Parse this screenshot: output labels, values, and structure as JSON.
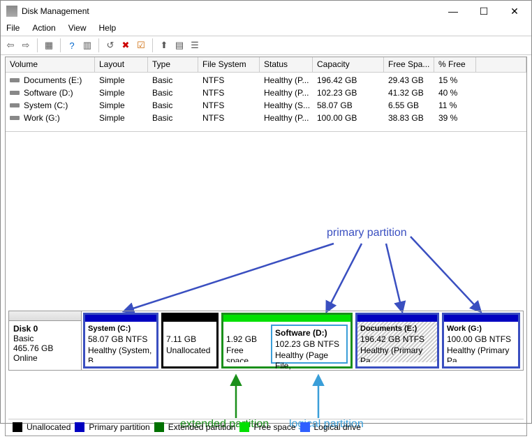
{
  "window": {
    "title": "Disk Management"
  },
  "menu": {
    "file": "File",
    "action": "Action",
    "view": "View",
    "help": "Help"
  },
  "columns": {
    "volume": "Volume",
    "layout": "Layout",
    "type": "Type",
    "fs": "File System",
    "status": "Status",
    "capacity": "Capacity",
    "free": "Free Spa...",
    "pct": "% Free"
  },
  "rows": [
    {
      "volume": "Documents (E:)",
      "layout": "Simple",
      "type": "Basic",
      "fs": "NTFS",
      "status": "Healthy (P...",
      "capacity": "196.42 GB",
      "free": "29.43 GB",
      "pct": "15 %"
    },
    {
      "volume": "Software (D:)",
      "layout": "Simple",
      "type": "Basic",
      "fs": "NTFS",
      "status": "Healthy (P...",
      "capacity": "102.23 GB",
      "free": "41.32 GB",
      "pct": "40 %"
    },
    {
      "volume": "System (C:)",
      "layout": "Simple",
      "type": "Basic",
      "fs": "NTFS",
      "status": "Healthy (S...",
      "capacity": "58.07 GB",
      "free": "6.55 GB",
      "pct": "11 %"
    },
    {
      "volume": "Work (G:)",
      "layout": "Simple",
      "type": "Basic",
      "fs": "NTFS",
      "status": "Healthy (P...",
      "capacity": "100.00 GB",
      "free": "38.83 GB",
      "pct": "39 %"
    }
  ],
  "disk": {
    "label": "Disk 0",
    "type": "Basic",
    "size": "465.76 GB",
    "state": "Online"
  },
  "parts": {
    "p0": {
      "name": "System  (C:)",
      "line2": "58.07 GB NTFS",
      "line3": "Healthy (System, B"
    },
    "p1": {
      "line2": "7.11 GB",
      "line3": "Unallocated"
    },
    "p2": {
      "line2": "1.92 GB",
      "line3": "Free space"
    },
    "p3": {
      "name": "Software  (D:)",
      "line2": "102.23 GB NTFS",
      "line3": "Healthy (Page File,"
    },
    "p4": {
      "name": "Documents  (E:)",
      "line2": "196.42 GB NTFS",
      "line3": "Healthy (Primary Pa"
    },
    "p5": {
      "name": "Work  (G:)",
      "line2": "100.00 GB NTFS",
      "line3": "Healthy (Primary Pa"
    }
  },
  "annotations": {
    "primary": "primary partition",
    "extended": "extended partition",
    "logical": "logical partition"
  },
  "legend": {
    "un": "Unallocated",
    "pp": "Primary partition",
    "ep": "Extended partition",
    "fs": "Free space",
    "ld": "Logical drive"
  },
  "winbtns": {
    "min": "—",
    "max": "☐",
    "close": "✕"
  }
}
